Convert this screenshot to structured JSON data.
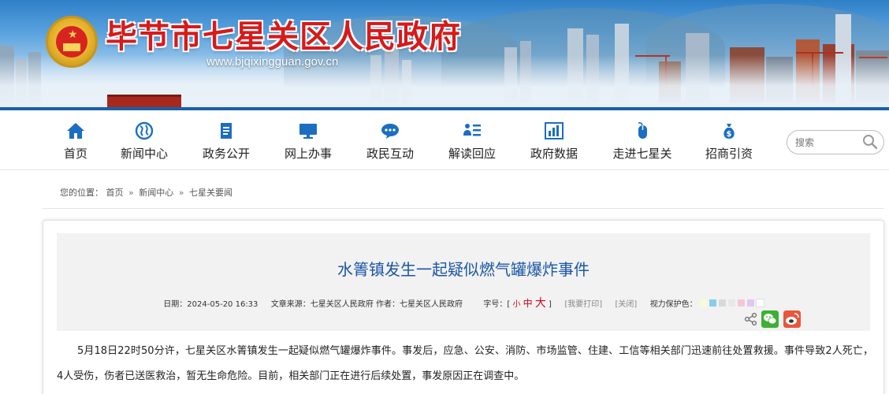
{
  "header": {
    "site_title": "毕节市七星关区人民政府",
    "site_url": "www.bjqixingguan.gov.cn"
  },
  "nav": {
    "items": [
      {
        "label": "首页",
        "icon": "home-icon"
      },
      {
        "label": "新闻中心",
        "icon": "globe-icon"
      },
      {
        "label": "政务公开",
        "icon": "document-icon"
      },
      {
        "label": "网上办事",
        "icon": "monitor-icon"
      },
      {
        "label": "政民互动",
        "icon": "chat-icon"
      },
      {
        "label": "解读回应",
        "icon": "list-icon"
      },
      {
        "label": "政府数据",
        "icon": "bar-chart-icon"
      },
      {
        "label": "走进七星关",
        "icon": "mouse-icon"
      },
      {
        "label": "招商引资",
        "icon": "money-bag-icon"
      }
    ],
    "search_placeholder": "搜索"
  },
  "breadcrumb": {
    "prefix": "您的位置：",
    "items": [
      "首页",
      "新闻中心",
      "七星关要闻"
    ],
    "separator": "»"
  },
  "article": {
    "title": "水箐镇发生一起疑似燃气罐爆炸事件",
    "meta": {
      "date_label": "日期：",
      "date": "2024-05-20 16:33",
      "source_label": "文章来源：",
      "source": "七星关区人民政府",
      "author_label": "作者：",
      "author": "七星关区人民政府",
      "font_size_label": "字号：",
      "font_small": "小",
      "font_medium": "中",
      "font_large": "大",
      "print_label": "[我要打印]",
      "close_label": "[关闭]",
      "eye_care_label": "视力保护色："
    },
    "eye_care_colors": [
      "#fafad2",
      "#87ceeb",
      "#d9d9d9",
      "#e8e8e8",
      "#f5c6d6",
      "#e0c8f0",
      "#ffffff"
    ],
    "share": {
      "share_icon": "share-icon",
      "wechat_color": "#3cb034",
      "weibo_color": "#e8573a"
    },
    "body": "5月18日22时50分许，七星关区水箐镇发生一起疑似燃气罐爆炸事件。事发后，应急、公安、消防、市场监管、住建、工信等相关部门迅速前往处置救援。事件导致2人死亡，4人受伤，伤者已送医救治，暂无生命危险。目前，相关部门正在进行后续处置，事发原因正在调查中。"
  }
}
